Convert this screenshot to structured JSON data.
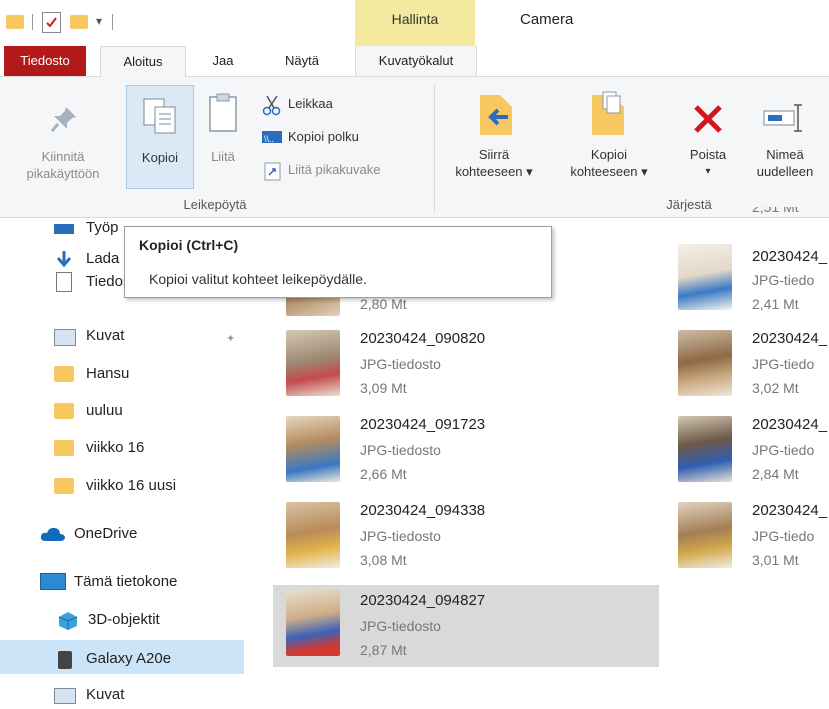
{
  "window": {
    "title": "Camera",
    "contextual_group": "Hallinta"
  },
  "tabs": {
    "file": "Tiedosto",
    "home": "Aloitus",
    "share": "Jaa",
    "view": "Näytä",
    "picture_tools": "Kuvatyökalut"
  },
  "ribbon": {
    "clipboard": {
      "pin_line1": "Kiinnitä",
      "pin_line2": "pikakäyttöön",
      "copy": "Kopioi",
      "paste": "Liitä",
      "cut": "Leikkaa",
      "copy_path": "Kopioi polku",
      "paste_shortcut": "Liitä pikakuvake",
      "group_label": "Leikepöytä"
    },
    "organize": {
      "move_line1": "Siirrä",
      "move_line2": "kohteeseen ▾",
      "copyto_line1": "Kopioi",
      "copyto_line2": "kohteeseen ▾",
      "group_label": "Järjestä"
    },
    "delete": "Poista",
    "delete_arrow": "▾",
    "rename_line1": "Nimeä",
    "rename_line2": "uudelleen"
  },
  "tooltip": {
    "title": "Kopioi (Ctrl+C)",
    "description": "Kopioi valitut kohteet leikepöydälle."
  },
  "nav": {
    "items": [
      {
        "label": "Työp"
      },
      {
        "label": "Lada"
      },
      {
        "label": "Tiedostot"
      },
      {
        "label": "Kuvat"
      },
      {
        "label": "Hansu"
      },
      {
        "label": "uuluu"
      },
      {
        "label": "viikko 16"
      },
      {
        "label": "viikko 16 uusi"
      },
      {
        "label": "OneDrive"
      },
      {
        "label": "Tämä tietokone"
      },
      {
        "label": "3D-objektit"
      },
      {
        "label": "Galaxy A20e"
      },
      {
        "label": "Kuvat"
      }
    ]
  },
  "files": {
    "left": [
      {
        "name": "",
        "type": "",
        "size": "2,80 Mt"
      },
      {
        "name": "20230424_090820",
        "type": "JPG-tiedosto",
        "size": "3,09 Mt"
      },
      {
        "name": "20230424_091723",
        "type": "JPG-tiedosto",
        "size": "2,66 Mt"
      },
      {
        "name": "20230424_094338",
        "type": "JPG-tiedosto",
        "size": "3,08 Mt"
      },
      {
        "name": "20230424_094827",
        "type": "JPG-tiedosto",
        "size": "2,87 Mt"
      }
    ],
    "right": [
      {
        "name": "",
        "type": "",
        "size": "2,51 Mt"
      },
      {
        "name": "20230424_",
        "type": "JPG-tiedo",
        "size": "2,41 Mt"
      },
      {
        "name": "20230424_",
        "type": "JPG-tiedo",
        "size": "3,02 Mt"
      },
      {
        "name": "20230424_",
        "type": "JPG-tiedo",
        "size": "2,84 Mt"
      },
      {
        "name": "20230424_",
        "type": "JPG-tiedo",
        "size": "3,01 Mt"
      }
    ]
  },
  "colors": {
    "file_tab": "#b21a1a",
    "contextual_tab": "#f3eaa0",
    "selection": "#cce4f7",
    "hover_button": "#dbe8f5",
    "delete_red": "#d3141e"
  }
}
